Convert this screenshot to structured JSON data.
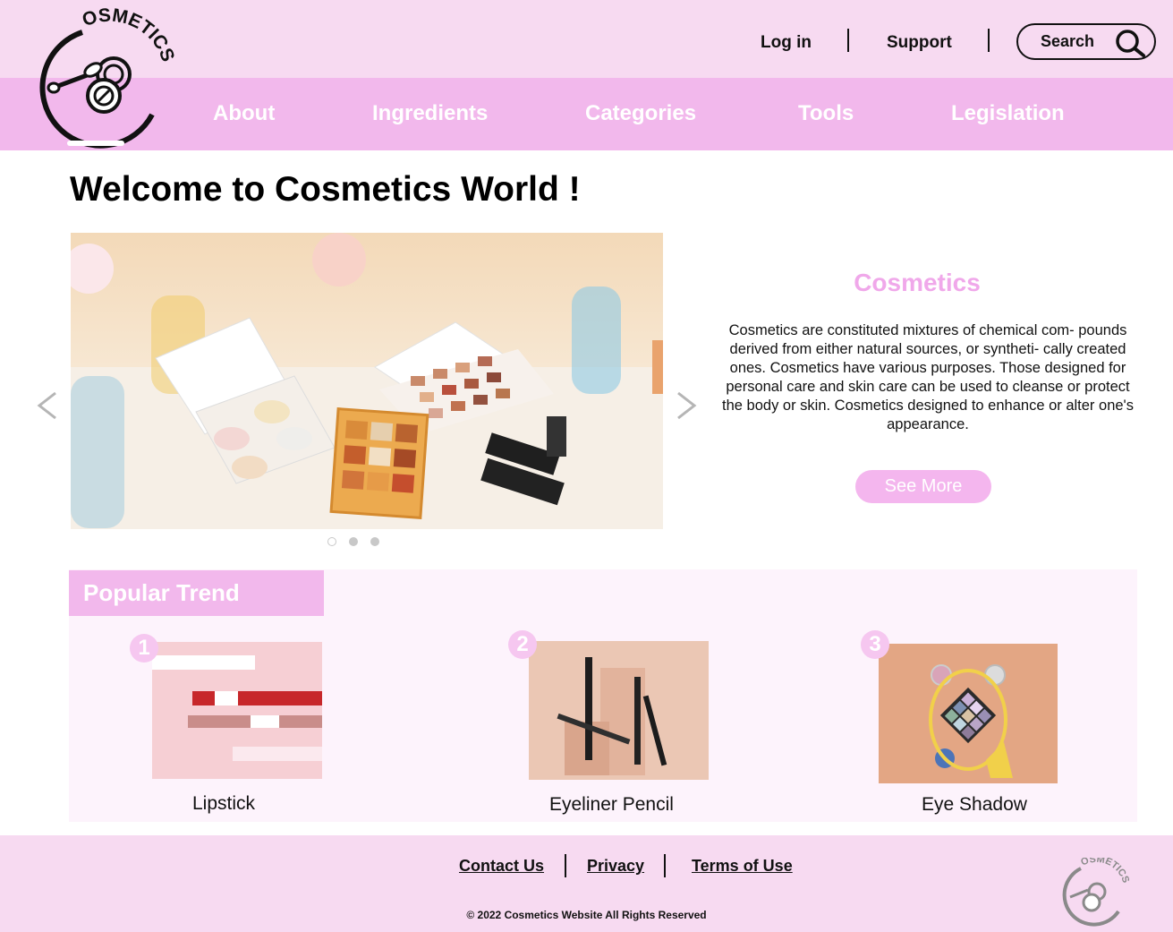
{
  "brand": {
    "logo_text": "OSMETICS",
    "accent": "#f2b8ec",
    "light": "#f7daf1"
  },
  "header": {
    "login_label": "Log in",
    "support_label": "Support",
    "search_label": "Search"
  },
  "nav": {
    "items": [
      {
        "label": "About"
      },
      {
        "label": "Ingredients"
      },
      {
        "label": "Categories"
      },
      {
        "label": "Tools"
      },
      {
        "label": "Legislation"
      }
    ]
  },
  "main": {
    "welcome": "Welcome to Cosmetics World !",
    "carousel": {
      "slide_count": 3,
      "active_index": 0,
      "prev_icon": "chevron-left-icon",
      "next_icon": "chevron-right-icon"
    },
    "info": {
      "title": "Cosmetics",
      "body": "Cosmetics are constituted mixtures of chemical com- pounds derived from either natural sources, or syntheti- cally created ones. Cosmetics have various purposes. Those designed for personal care and skin care can be used to cleanse or protect the body or skin. Cosmetics designed to enhance or alter one's appearance.",
      "button_label": "See More"
    }
  },
  "trend": {
    "title": "Popular Trend",
    "products": [
      {
        "rank": "1",
        "name": "Lipstick"
      },
      {
        "rank": "2",
        "name": "Eyeliner Pencil"
      },
      {
        "rank": "3",
        "name": "Eye Shadow"
      }
    ]
  },
  "footer": {
    "links": [
      {
        "label": "Contact Us"
      },
      {
        "label": "Privacy"
      },
      {
        "label": "Terms of Use"
      }
    ],
    "copyright": "© 2022 Cosmetics Website All Rights Reserved"
  }
}
